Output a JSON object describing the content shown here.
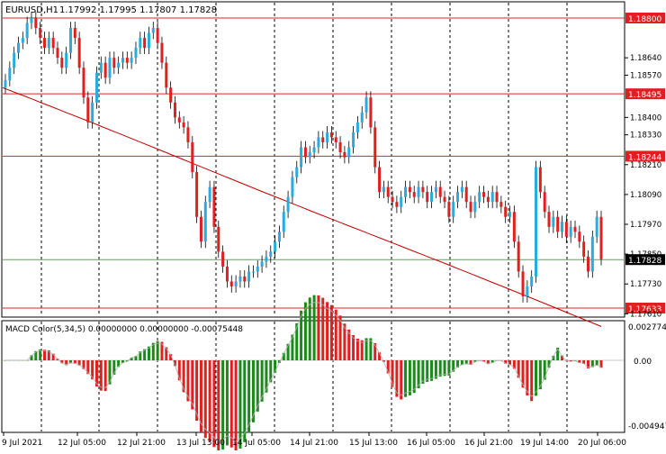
{
  "header": {
    "symbol": "EURUSD,H1",
    "ohlc": "1.17992 1.17995 1.17807 1.17828"
  },
  "macd": {
    "label": "MACD Color(5,34,5) 0.00000000 0.00000000 -0.00075448",
    "top_label": "0.0027741",
    "zero_label": "0.00",
    "bottom_label": "-0.0049470"
  },
  "chart_data": {
    "type": "candlestick",
    "price_axis_ticks": [
      "1.18800",
      "1.18495",
      "1.18330",
      "1.18244",
      "1.18210",
      "1.18090",
      "1.17970",
      "1.17850",
      "1.17828",
      "1.17730",
      "1.17633",
      "1.17610"
    ],
    "plain_ticks": [
      "1.18640",
      "1.18570",
      "1.18400",
      "1.18330",
      "1.18210",
      "1.18090",
      "1.17970",
      "1.17850",
      "1.17730",
      "1.17610"
    ],
    "horizontal_levels": [
      {
        "price": 1.188,
        "label": "1.18800"
      },
      {
        "price": 1.18495,
        "label": "1.18495"
      },
      {
        "price": 1.18244,
        "label": "1.18244"
      },
      {
        "price": 1.17633,
        "label": "1.17633"
      }
    ],
    "current_price": {
      "price": 1.17828,
      "label": "1.17828"
    },
    "time_labels": [
      "9 Jul 2021",
      "12 Jul 05:00",
      "12 Jul 21:00",
      "13 Jul 13:00",
      "14 Jul 05:00",
      "14 Jul 21:00",
      "15 Jul 13:00",
      "16 Jul 05:00",
      "16 Jul 21:00",
      "19 Jul 14:00",
      "20 Jul 06:00"
    ],
    "ma_period_color": "#c00000",
    "colors": {
      "bull": "#29aae1",
      "bear": "#e02020",
      "level": "#e02020",
      "macd_up": "#1a8a1a",
      "macd_down": "#e02020",
      "signal": "#b0b0b0"
    }
  }
}
